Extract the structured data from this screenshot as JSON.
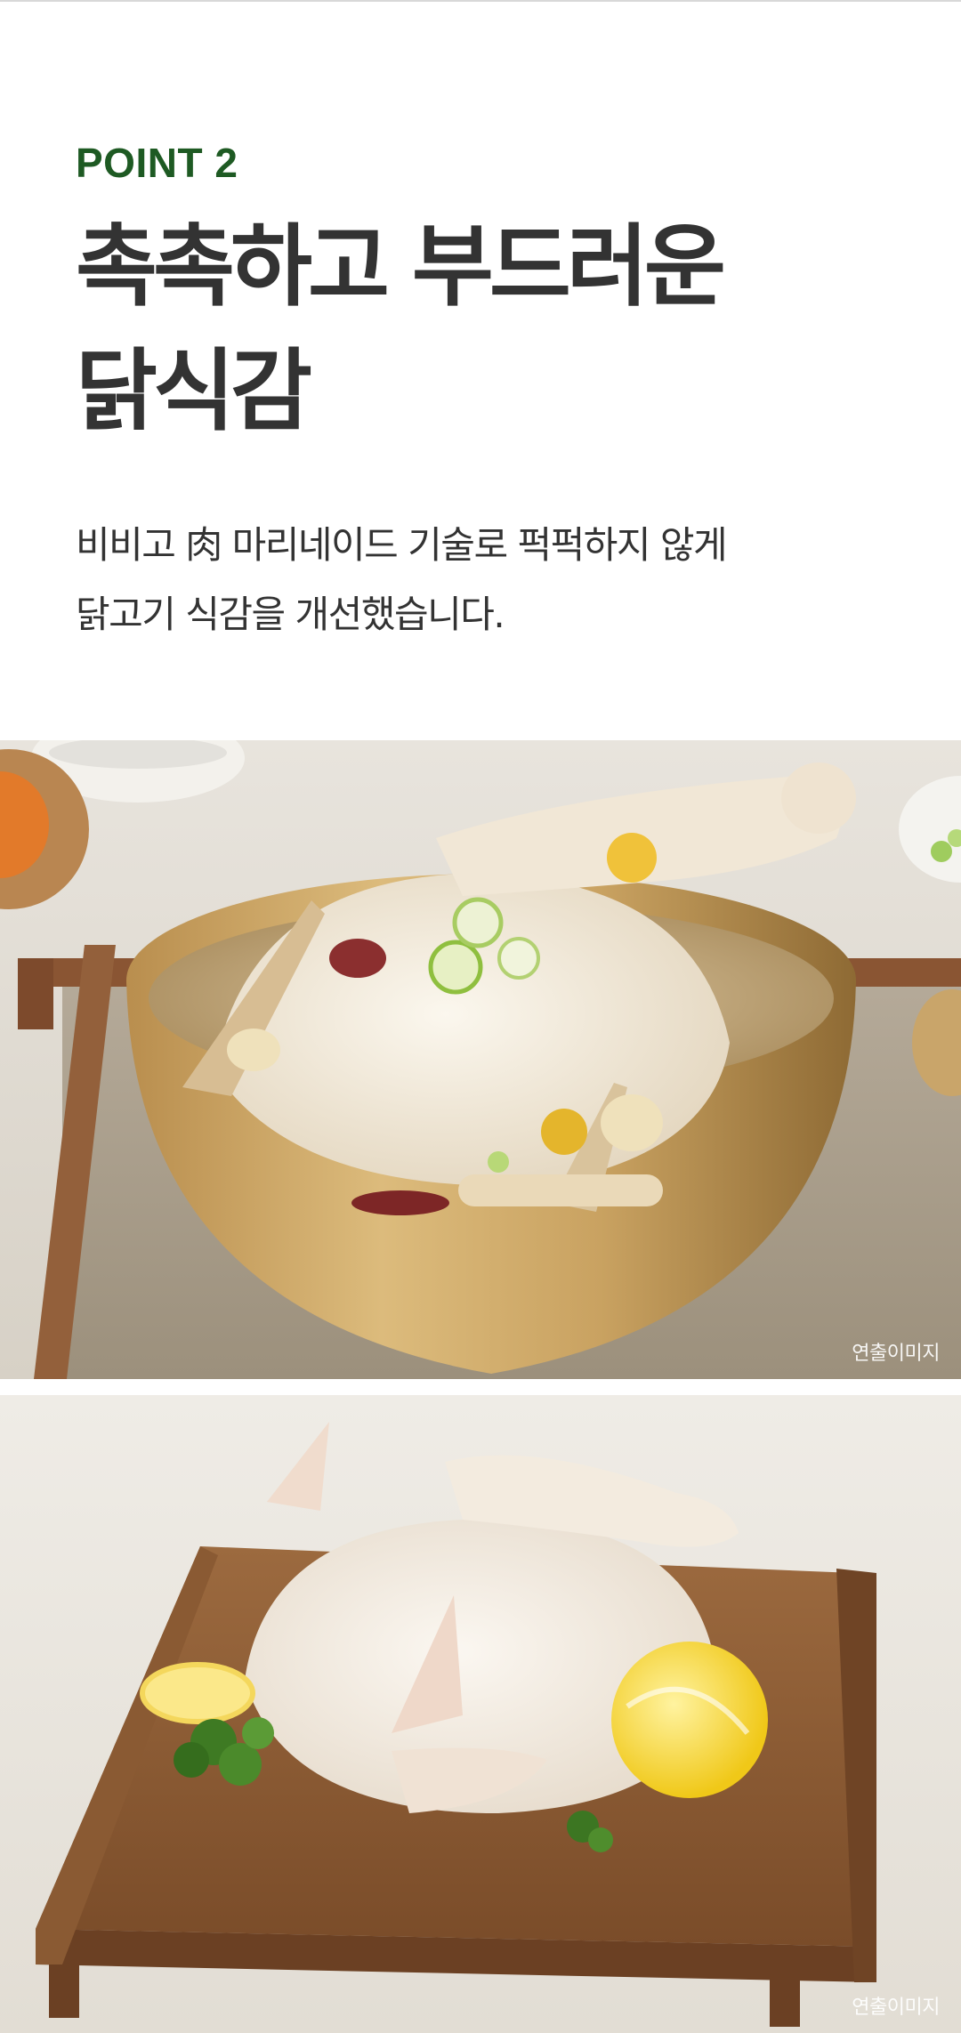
{
  "section": {
    "point_label": "POINT 2",
    "headline_line1": "촉촉하고 부드러운",
    "headline_line2": "닭식감",
    "desc_line1": "비비고 肉 마리네이드 기술로 퍽퍽하지 않게",
    "desc_line2": "닭고기 식감을 개선했습니다."
  },
  "images": {
    "samgyetang_watermark": "연출이미지",
    "raw_chicken_watermark": "연출이미지"
  },
  "colors": {
    "point_label": "#1e5a23",
    "headline": "#333333",
    "body_text": "#333333",
    "background": "#ffffff"
  }
}
